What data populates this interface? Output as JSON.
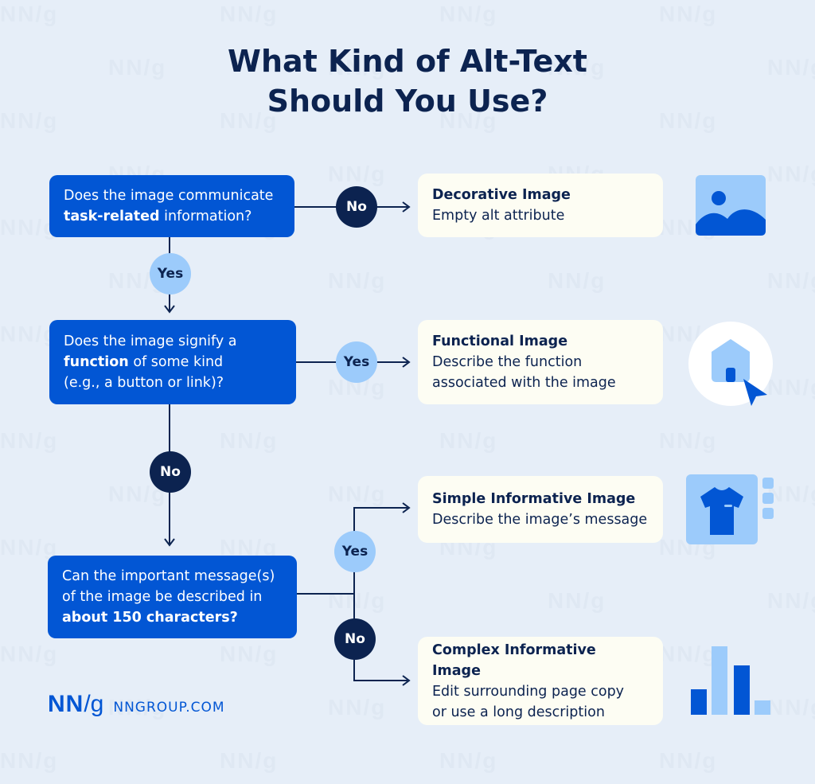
{
  "title": {
    "line1": "What Kind of Alt-Text",
    "line2": "Should You Use?"
  },
  "questions": [
    {
      "pre": "Does the image communicate",
      "bold": "task-related",
      "post": " information?"
    },
    {
      "pre": "Does the image signify a",
      "bold": "function",
      "post": " of some kind",
      "extra": "(e.g., a button or link)?"
    },
    {
      "pre": "Can the important message(s)",
      "line2": "of the image be described in",
      "bold": "about 150 characters?"
    }
  ],
  "badges": {
    "q1_no": "No",
    "q1_yes": "Yes",
    "q2_yes": "Yes",
    "q2_no": "No",
    "q3_yes": "Yes",
    "q3_no": "No"
  },
  "outcomes": [
    {
      "heading": "Decorative Image",
      "desc1": "Empty alt attribute",
      "icon": "landscape-image-icon"
    },
    {
      "heading": "Functional Image",
      "desc1": "Describe the function",
      "desc2": "associated with the image",
      "icon": "home-click-icon"
    },
    {
      "heading": "Simple Informative Image",
      "desc1": "Describe the image’s message",
      "icon": "tshirt-product-icon"
    },
    {
      "heading": "Complex Informative Image",
      "desc1": "Edit surrounding page copy",
      "desc2": "or use a long description",
      "icon": "bar-chart-icon"
    }
  ],
  "logo": {
    "mark": "NN",
    "slash": "/g",
    "url": "NNGROUP.COM"
  },
  "watermark": "NN/g",
  "colors": {
    "background": "#e6eef8",
    "primary_blue": "#0256d4",
    "light_blue": "#9ccbfb",
    "navy": "#0c2350",
    "card": "#fdfdf3"
  }
}
